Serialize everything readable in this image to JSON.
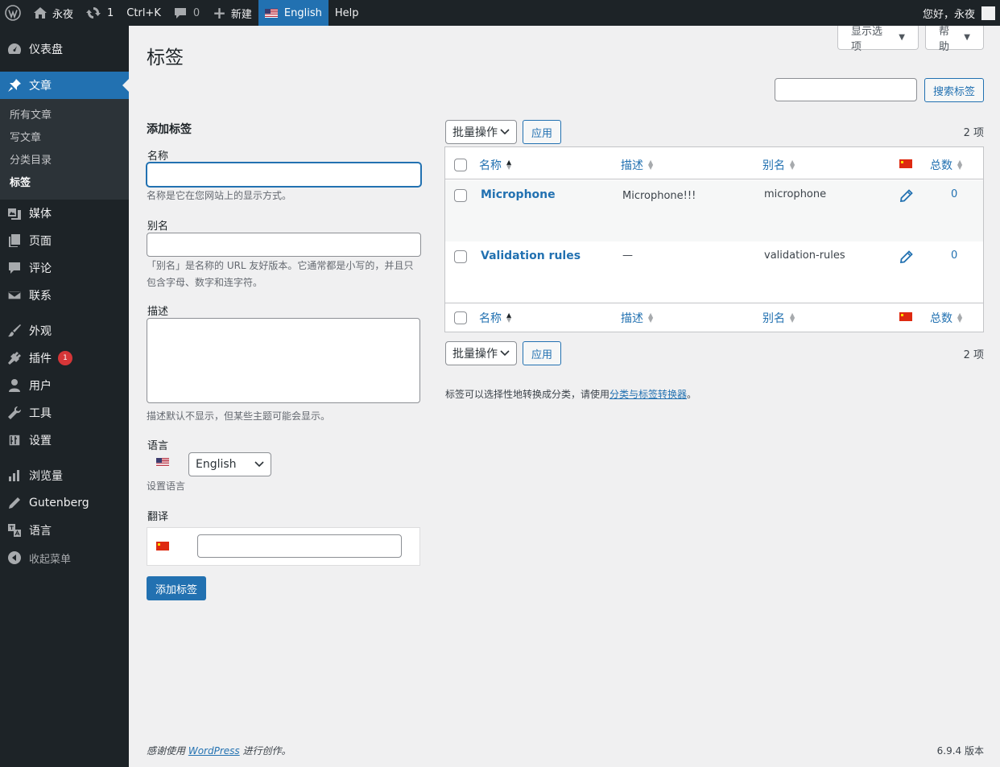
{
  "admin_bar": {
    "site_name": "永夜",
    "updates_count": "1",
    "shortcut": "Ctrl+K",
    "comments_count": "0",
    "new_label": "新建",
    "language": "English",
    "help": "Help",
    "greeting": "您好，永夜"
  },
  "sidebar": {
    "dashboard": "仪表盘",
    "posts": "文章",
    "posts_sub": [
      "所有文章",
      "写文章",
      "分类目录",
      "标签"
    ],
    "media": "媒体",
    "pages": "页面",
    "comments": "评论",
    "contact": "联系",
    "appearance": "外观",
    "plugins": "插件",
    "plugins_badge": "1",
    "users": "用户",
    "tools": "工具",
    "settings": "设置",
    "stats": "浏览量",
    "gutenberg": "Gutenberg",
    "languages": "语言",
    "collapse": "收起菜单"
  },
  "header": {
    "title": "标签",
    "screen_options": "显示选项",
    "help": "帮助"
  },
  "search": {
    "value": "",
    "button": "搜索标签"
  },
  "form": {
    "heading": "添加标签",
    "name_label": "名称",
    "name_help": "名称是它在您网站上的显示方式。",
    "slug_label": "别名",
    "slug_help": "「别名」是名称的 URL 友好版本。它通常都是小写的，并且只包含字母、数字和连字符。",
    "desc_label": "描述",
    "desc_help": "描述默认不显示，但某些主题可能会显示。",
    "lang_label": "语言",
    "lang_value": "English",
    "lang_help": "设置语言",
    "translations_label": "翻译",
    "submit": "添加标签"
  },
  "table": {
    "bulk_actions": "批量操作",
    "apply": "应用",
    "count": "2 项",
    "columns": {
      "name": "名称",
      "description": "描述",
      "slug": "别名",
      "count": "总数"
    },
    "rows": [
      {
        "name": "Microphone",
        "description": "Microphone!!!",
        "slug": "microphone",
        "count": "0"
      },
      {
        "name": "Validation rules",
        "description": "—",
        "slug": "validation-rules",
        "count": "0"
      }
    ]
  },
  "note": {
    "text": "标签可以选择性地转换成分类，请使用",
    "link": "分类与标签转换器",
    "end": "。"
  },
  "footer": {
    "pre": "感谢使用",
    "link": "WordPress",
    "post": "进行创作。",
    "version": "6.9.4 版本"
  },
  "colors": {
    "accent": "#2271b1",
    "sidebar": "#1d2327",
    "badge": "#d63638"
  }
}
